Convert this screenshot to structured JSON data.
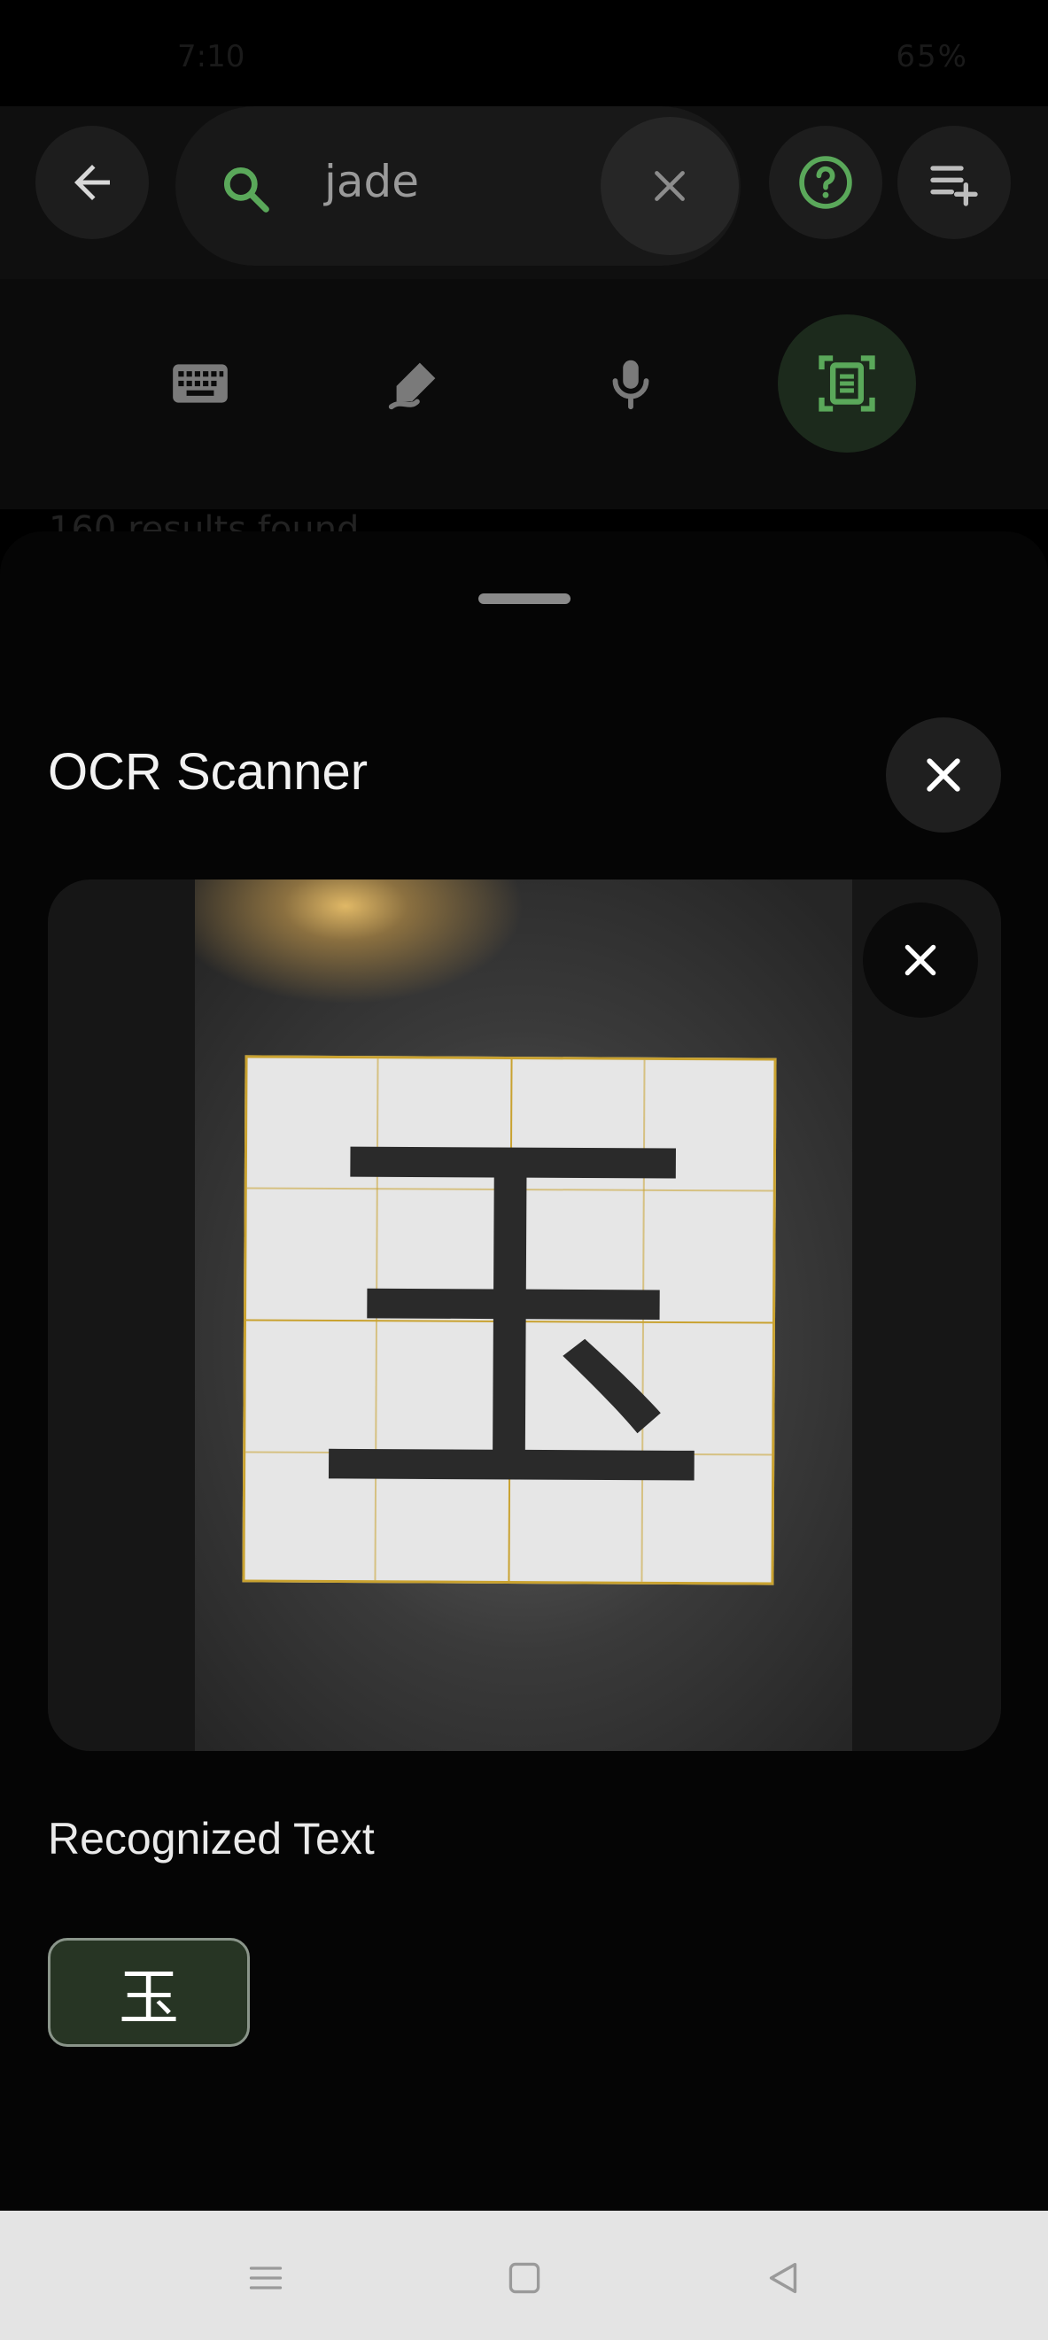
{
  "status_bar": {
    "time": "7:10",
    "right_text": "65%"
  },
  "search": {
    "query": "jade"
  },
  "results_count_text": "160 results found",
  "input_modes": [
    {
      "name": "keyboard",
      "active": false
    },
    {
      "name": "handwriting",
      "active": false
    },
    {
      "name": "voice",
      "active": false
    },
    {
      "name": "ocr",
      "active": true
    }
  ],
  "sheet": {
    "title": "OCR Scanner",
    "recognized_label": "Recognized Text",
    "recognized_items": [
      "玉"
    ],
    "photo_character": "玉"
  },
  "colors": {
    "accent_green": "#5aa85a",
    "active_mode_bg": "#1c2a1c",
    "chip_bg": "#273524",
    "sheet_bg": "#050505"
  },
  "icons": {
    "back": "arrow-left-icon",
    "search": "search-icon",
    "clear": "close-icon",
    "help": "help-circle-icon",
    "add_list": "playlist-add-icon",
    "keyboard": "keyboard-icon",
    "handwriting": "draw-icon",
    "voice": "microphone-icon",
    "ocr": "document-scanner-icon",
    "nav_menu": "menu-icon",
    "nav_home": "home-square-icon",
    "nav_back": "back-triangle-icon"
  }
}
